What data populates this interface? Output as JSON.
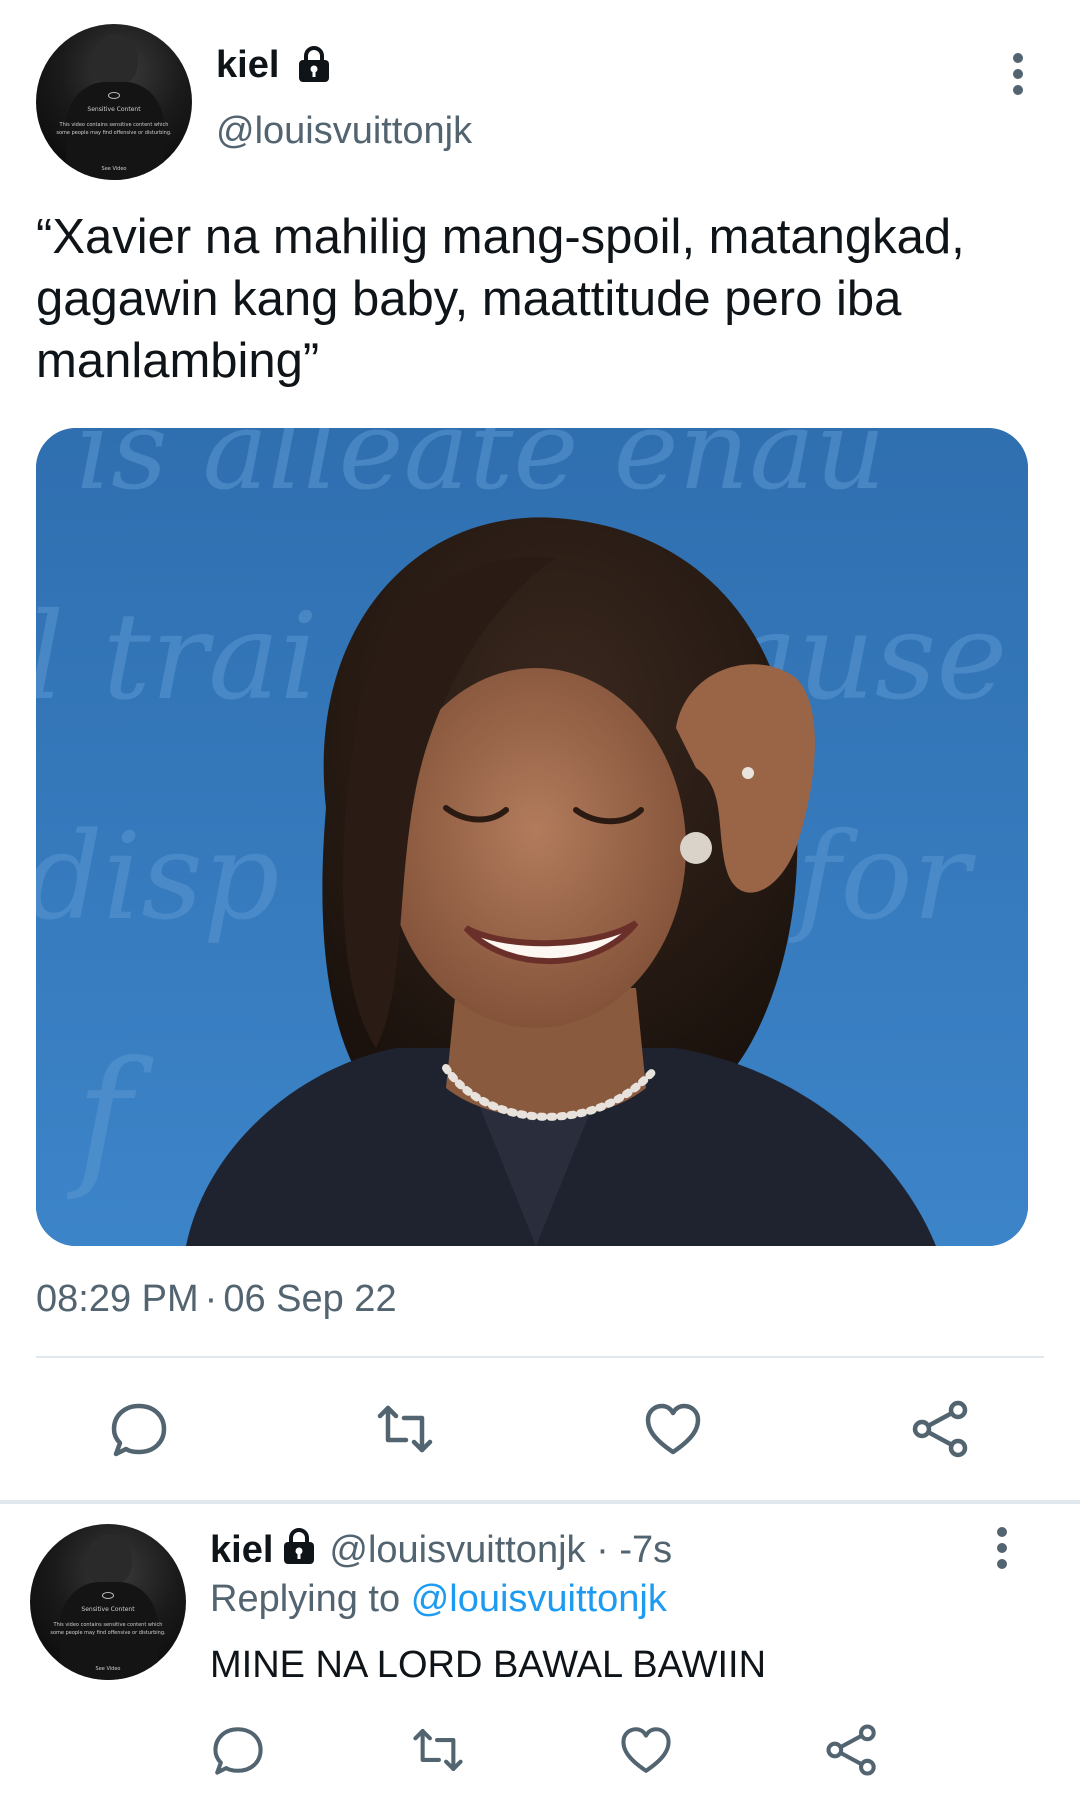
{
  "main_tweet": {
    "display_name": "kiel",
    "handle": "@louisvuittonjk",
    "text": "“Xavier na mahilig mang-spoil, matangkad, gagawin kang baby, maattitude pero iba manlambing”",
    "timestamp_time": "08:29 PM",
    "timestamp_sep": "·",
    "timestamp_date": "06 Sep 22",
    "avatar_overlay": {
      "title": "Sensitive Content",
      "line1": "This video contains sensitive content which",
      "line2": "some people may find offensive or disturbing.",
      "button": "See Video"
    },
    "icons": {
      "lock": "lock-icon",
      "more": "more-vertical-icon",
      "reply": "reply-icon",
      "retweet": "retweet-icon",
      "like": "heart-icon",
      "share": "share-icon"
    }
  },
  "reply_tweet": {
    "display_name": "kiel",
    "handle": "@louisvuittonjk",
    "meta_sep": "·",
    "time_ago": "-7s",
    "replying_label": "Replying to",
    "replying_mention": "@louisvuittonjk",
    "text": "MINE NA LORD BAWAL BAWIIN",
    "avatar_overlay": {
      "title": "Sensitive Content",
      "line1": "This video contains sensitive content which",
      "line2": "some people may find offensive or disturbing.",
      "button": "See Video"
    }
  },
  "colors": {
    "text_primary": "#0f1419",
    "text_secondary": "#536471",
    "link": "#1d9bf0",
    "divider": "#e1e8ed",
    "media_background": "#3a7bbd"
  }
}
